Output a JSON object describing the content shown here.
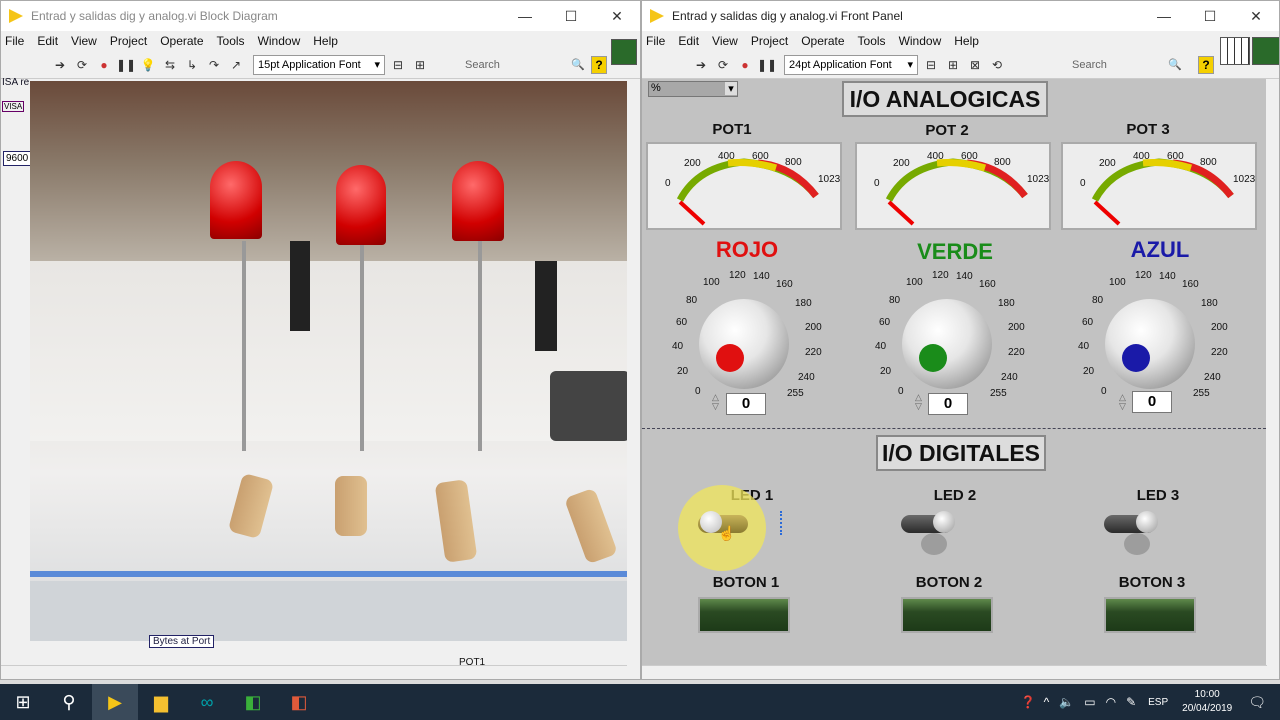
{
  "left_window": {
    "title": "Entrad y salidas dig y analog.vi Block Diagram",
    "menu": [
      "File",
      "Edit",
      "View",
      "Project",
      "Operate",
      "Tools",
      "Window",
      "Help"
    ],
    "font": "15pt Application Font",
    "search_placeholder": "Search",
    "side_labels": [
      "ISA re",
      "VISA",
      "9600"
    ],
    "bottom_labels": [
      "Bytes at Port",
      "POT1"
    ]
  },
  "right_window": {
    "title": "Entrad y salidas dig y analog.vi Front Panel",
    "menu": [
      "File",
      "Edit",
      "View",
      "Project",
      "Operate",
      "Tools",
      "Window",
      "Help"
    ],
    "font": "24pt Application Font",
    "search_placeholder": "Search",
    "sizer": "%"
  },
  "analog": {
    "title": "I/O ANALOGICAS",
    "gauges": [
      {
        "label": "POT1",
        "value": 0
      },
      {
        "label": "POT 2",
        "value": 0
      },
      {
        "label": "POT 3",
        "value": 0
      }
    ],
    "gauge_ticks": [
      "0",
      "200",
      "400",
      "600",
      "800",
      "1023"
    ],
    "knobs": [
      {
        "label": "ROJO",
        "color": "#e01010",
        "value": "0"
      },
      {
        "label": "VERDE",
        "color": "#1a8c1a",
        "value": "0"
      },
      {
        "label": "AZUL",
        "color": "#1a1aa8",
        "value": "0"
      }
    ],
    "knob_ticks": [
      "0",
      "20",
      "40",
      "60",
      "80",
      "100",
      "120",
      "140",
      "160",
      "180",
      "200",
      "220",
      "240",
      "255"
    ]
  },
  "digital": {
    "title": "I/O DIGITALES",
    "leds": [
      "LED 1",
      "LED 2",
      "LED 3"
    ],
    "botones": [
      "BOTON 1",
      "BOTON 2",
      "BOTON 3"
    ]
  },
  "taskbar": {
    "time": "10:00",
    "date": "20/04/2019",
    "lang": "ESP"
  }
}
